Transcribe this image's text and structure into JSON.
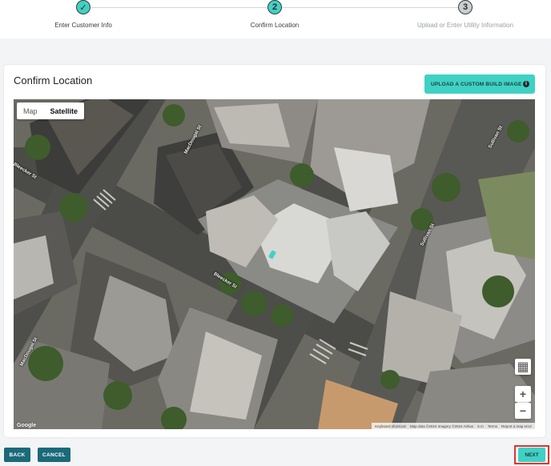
{
  "stepper": {
    "steps": [
      {
        "number": "1",
        "label": "Enter Customer Info",
        "state": "complete",
        "icon": "check-icon"
      },
      {
        "number": "2",
        "label": "Confirm Location",
        "state": "active"
      },
      {
        "number": "3",
        "label": "Upload or Enter Utility Information",
        "state": "pending"
      }
    ],
    "check_glyph": "✓"
  },
  "card": {
    "title": "Confirm Location",
    "upload_button_label": "UPLOAD A CUSTOM BUILD IMAGE",
    "info_glyph": "i"
  },
  "map": {
    "type_buttons": [
      "Map",
      "Satellite"
    ],
    "selected_type": "Satellite",
    "layers_glyph": "▦",
    "zoom_in_glyph": "+",
    "zoom_out_glyph": "−",
    "google_label": "Google",
    "attribution": {
      "shortcuts": "Keyboard shortcuts",
      "data": "Map data ©2024 Imagery ©2024 Airbus",
      "scale": "5 m",
      "terms": "Terms",
      "report": "Report a map error"
    },
    "streets": {
      "macdougal_top": "MacDougal St",
      "bleecker_left": "Bleecker St",
      "sullivan_top": "Sullivan St",
      "sullivan_mid": "Sullivan St",
      "bleecker_mid": "Bleecker St",
      "macdougal_bottom": "MacDougal St"
    }
  },
  "footer": {
    "back_label": "BACK",
    "cancel_label": "CANCEL",
    "next_label": "NEXT"
  },
  "colors": {
    "accent": "#3fd1c4",
    "dark_button": "#1a6a7a",
    "highlight_outline": "#e03333"
  }
}
